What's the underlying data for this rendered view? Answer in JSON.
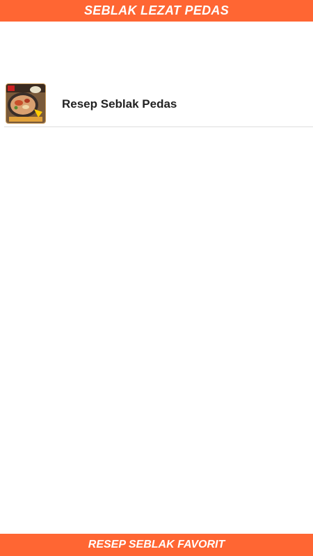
{
  "header": {
    "title": "SEBLAK LEZAT PEDAS"
  },
  "recipes": {
    "items": [
      {
        "label": "Resep Seblak Pedas",
        "thumbnail_caption": "RESEP SEBLAK",
        "icon": "seblak-dish-thumbnail"
      }
    ]
  },
  "footer": {
    "label": "RESEP SEBLAK FAVORIT"
  },
  "colors": {
    "accent": "#ff6633",
    "text": "#222222",
    "divider": "#dddddd"
  }
}
